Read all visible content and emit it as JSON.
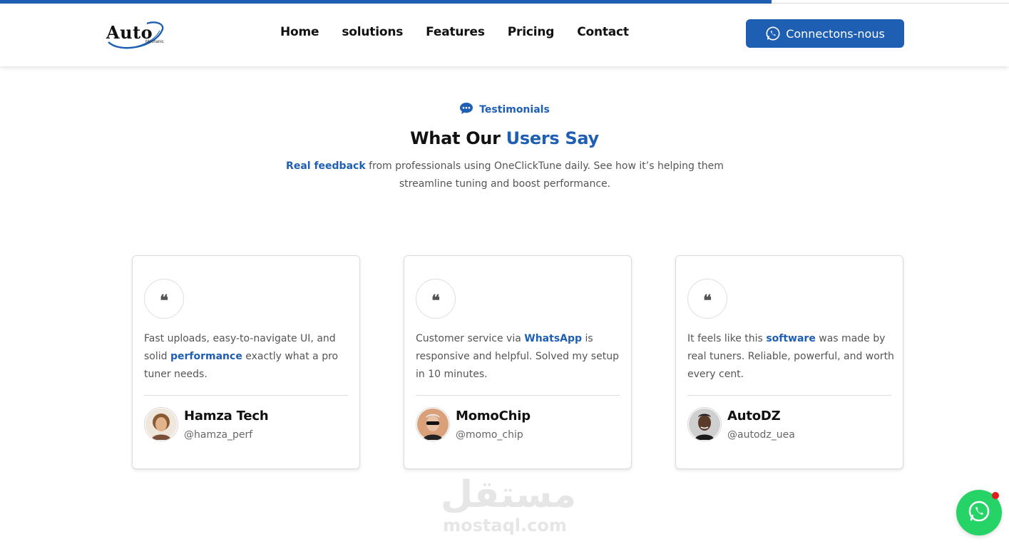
{
  "colors": {
    "accent": "#1f5fb3",
    "whatsapp": "#25d366",
    "notification": "#e21b1b"
  },
  "scroll_progress": 0.765,
  "logo": {
    "text": "Auto",
    "sub": "Mechanic"
  },
  "nav": {
    "items": [
      {
        "label": "Home"
      },
      {
        "label": "solutions"
      },
      {
        "label": "Features"
      },
      {
        "label": "Pricing"
      },
      {
        "label": "Contact"
      }
    ]
  },
  "cta": {
    "label": "Connectons-nous",
    "icon": "whatsapp-icon"
  },
  "section": {
    "tag": "Testimonials",
    "tag_icon": "chat-bubble-icon",
    "title_part1": "What Our ",
    "title_highlight": "Users Say",
    "subtitle_highlight": "Real feedback",
    "subtitle_rest": " from professionals using OneClickTune daily. See how it’s helping them streamline tuning and boost performance."
  },
  "testimonials": [
    {
      "quote_mark": "❝",
      "text_before": "Fast uploads, easy-to-navigate UI, and solid ",
      "text_highlight": "performance",
      "text_after": " exactly what a pro tuner needs.",
      "name": "Hamza Tech",
      "handle": "@hamza_perf"
    },
    {
      "quote_mark": "❝",
      "text_before": "Customer service via ",
      "text_highlight": "WhatsApp",
      "text_after": " is responsive and helpful. Solved my setup in 10 minutes.",
      "name": "MomoChip",
      "handle": "@momo_chip"
    },
    {
      "quote_mark": "❝",
      "text_before": "It feels like this ",
      "text_highlight": "software",
      "text_after": " was made by real tuners. Reliable, powerful, and worth every cent.",
      "name": "AutoDZ",
      "handle": "@autodz_uea"
    }
  ],
  "watermark": {
    "arabic": "مستقل",
    "latin": "mostaql.com"
  },
  "floating_button": {
    "icon": "whatsapp-icon",
    "has_notification": true
  }
}
